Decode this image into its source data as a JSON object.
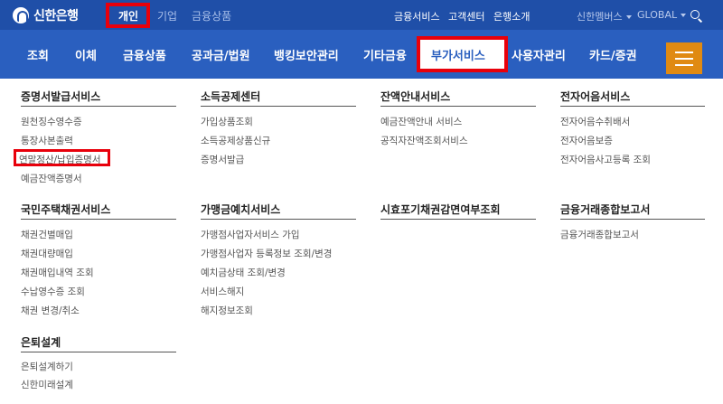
{
  "brand": {
    "name": "신한은행"
  },
  "segments": [
    "개인",
    "기업",
    "금융상품"
  ],
  "utility": [
    "금융서비스",
    "고객센터",
    "은행소개"
  ],
  "utility_right": [
    "신한멤버스",
    "GLOBAL"
  ],
  "nav": [
    "조회",
    "이체",
    "금융상품",
    "공과금/법원",
    "뱅킹보안관리",
    "기타금융",
    "부가서비스",
    "사용자관리",
    "카드/증권"
  ],
  "menu": {
    "col1": {
      "title": "증명서발급서비스",
      "items": [
        "원천징수영수증",
        "통장사본출력",
        "연말정산/납입증명서",
        "예금잔액증명서"
      ]
    },
    "col2": {
      "title": "소득공제센터",
      "items": [
        "가입상품조회",
        "소득공제상품신규",
        "증명서발급"
      ]
    },
    "col3": {
      "title": "잔액안내서비스",
      "items": [
        "예금잔액안내 서비스",
        "공직자잔액조회서비스"
      ]
    },
    "col4": {
      "title": "전자어음서비스",
      "items": [
        "전자어음수취배서",
        "전자어음보증",
        "전자어음사고등록 조회"
      ]
    },
    "col5": {
      "title": "국민주택채권서비스",
      "items": [
        "채권건별매입",
        "채권대량매입",
        "채권매입내역 조회",
        "수납영수증 조회",
        "채권 변경/취소"
      ]
    },
    "col6": {
      "title": "가맹금예치서비스",
      "items": [
        "가맹점사업자서비스 가입",
        "가맹점사업자 등록정보 조회/변경",
        "예치금상태 조회/변경",
        "서비스해지",
        "해지정보조회"
      ]
    },
    "col7": {
      "title": "시효포기채권감면여부조회",
      "items": []
    },
    "col8": {
      "title": "금융거래종합보고서",
      "items": [
        "금융거래종합보고서"
      ]
    },
    "col9": {
      "title": "은퇴설계",
      "items": [
        "은퇴설계하기",
        "신한미래설계"
      ]
    }
  }
}
